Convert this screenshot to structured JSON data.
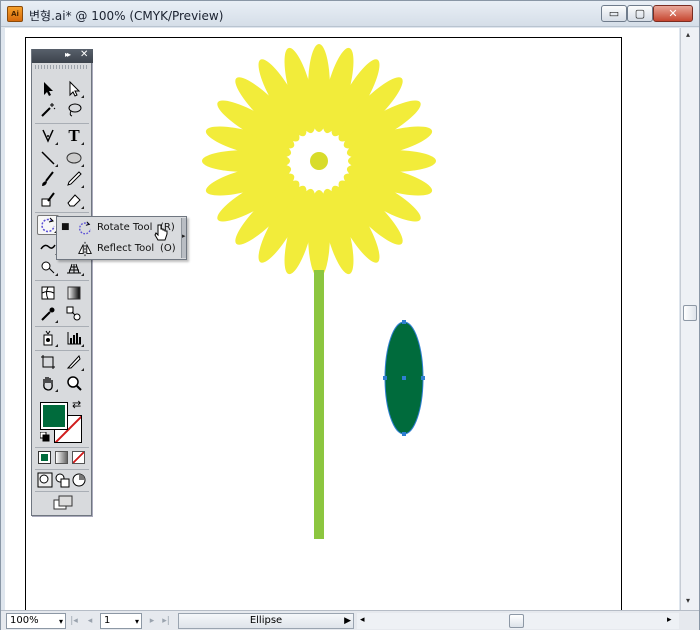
{
  "window": {
    "title": "변형.ai* @ 100% (CMYK/Preview)",
    "app_icon_text": "Ai",
    "minimize_symbol": "▭",
    "maximize_symbol": "▢",
    "close_symbol": "✕"
  },
  "tools_panel": {
    "collapse_symbol": "▸▸",
    "close_symbol": "✕",
    "type_tool_glyph": "T",
    "tools": [
      "selection-tool",
      "direct-selection-tool",
      "magic-wand-tool",
      "lasso-tool",
      "pen-tool",
      "type-tool",
      "line-segment-tool",
      "ellipse-tool",
      "paintbrush-tool",
      "pencil-tool",
      "blob-brush-tool",
      "eraser-tool",
      "rotate-tool",
      "scale-tool",
      "warp-tool",
      "free-transform-tool",
      "shape-builder-tool",
      "perspective-grid-tool",
      "mesh-tool",
      "gradient-tool",
      "eyedropper-tool",
      "blend-tool",
      "symbol-sprayer-tool",
      "column-graph-tool",
      "artboard-tool",
      "slice-tool",
      "hand-tool",
      "zoom-tool"
    ],
    "fill_color": "#006b3c",
    "stroke_color": "none"
  },
  "flyout": {
    "items": [
      {
        "label": "Rotate Tool",
        "shortcut": "(R)",
        "checked": true,
        "check_mark": "■"
      },
      {
        "label": "Reflect Tool",
        "shortcut": "(O)",
        "checked": false,
        "check_mark": ""
      }
    ]
  },
  "artwork": {
    "petal_color": "#f2ec3a",
    "center_color": "#d8dc2a",
    "stem_color": "#8cc63f",
    "leaf_color": "#006b3c",
    "selection_color": "#2f7fd1"
  },
  "status_bar": {
    "zoom": "100%",
    "page": "1",
    "status_text": "Ellipse",
    "dropdown_symbol": "▾",
    "play_symbol": "▶",
    "first": "|◂",
    "prev": "◂",
    "next": "▸",
    "last": "▸|",
    "left_arrow": "◂",
    "right_arrow": "▸",
    "up_arrow": "▴",
    "down_arrow": "▾"
  }
}
